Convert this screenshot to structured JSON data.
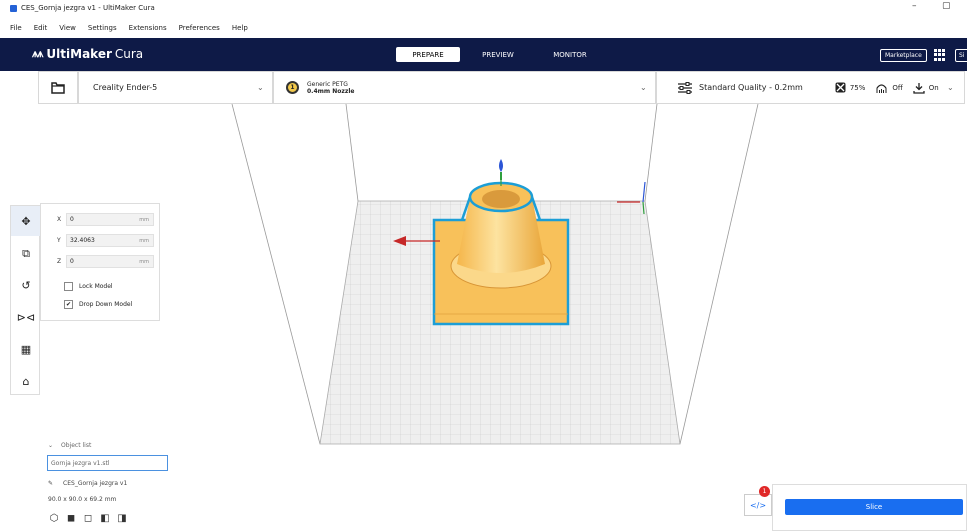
{
  "window": {
    "title": "CES_Gornja jezgra v1 - UltiMaker Cura",
    "minimize": "–",
    "restore": "▢"
  },
  "menu": [
    "File",
    "Edit",
    "View",
    "Settings",
    "Extensions",
    "Preferences",
    "Help"
  ],
  "header": {
    "logo_mark": "𝐉𝐀",
    "logo_brand": "UltiMaker",
    "logo_product": "Cura",
    "stages": [
      "PREPARE",
      "PREVIEW",
      "MONITOR"
    ],
    "active_stage": "PREPARE",
    "marketplace_label": "Marketplace",
    "signin_label": "Si"
  },
  "jobbar": {
    "printer": "Creality Ender-5",
    "nozzle_number": "1",
    "material": "Generic PETG",
    "nozzle": "0.4mm Nozzle",
    "quality": "Standard Quality - 0.2mm",
    "infill": "75%",
    "support": "Off",
    "adhesion": "On"
  },
  "move_tool": {
    "x_label": "X",
    "x_value": "0",
    "y_label": "Y",
    "y_value": "32.4063",
    "z_label": "Z",
    "z_value": "0",
    "unit": "mm",
    "lock_model": "Lock Model",
    "lock_checked": false,
    "drop_down": "Drop Down Model",
    "drop_down_checked": true
  },
  "tools": [
    "move-icon",
    "scale-icon",
    "rotate-icon",
    "mirror-icon",
    "per-model-settings-icon",
    "support-blocker-icon"
  ],
  "object_list": {
    "header": "Object list",
    "item": "Gornja jezgra v1.stl",
    "job_name": "CES_Gornja jezgra v1",
    "dimensions": "90.0 x 90.0 x 69.2 mm"
  },
  "slice": {
    "label": "Slice",
    "notification_count": "1",
    "code_icon": "</>"
  },
  "colors": {
    "header_bg": "#0e1a47",
    "accent": "#196ef0",
    "model": "#f8c15a",
    "model_outline": "#1c9ed6"
  }
}
